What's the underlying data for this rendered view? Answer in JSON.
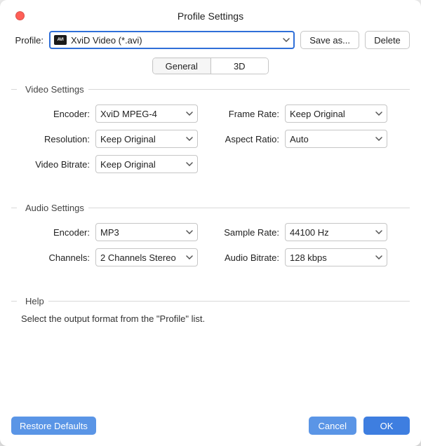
{
  "window": {
    "title": "Profile Settings"
  },
  "profileRow": {
    "label": "Profile:",
    "value": "XviD Video (*.avi)",
    "saveAs": "Save as...",
    "delete": "Delete"
  },
  "tabs": {
    "general": "General",
    "threeD": "3D"
  },
  "video": {
    "title": "Video Settings",
    "encoder": {
      "label": "Encoder:",
      "value": "XviD MPEG-4"
    },
    "resolution": {
      "label": "Resolution:",
      "value": "Keep Original"
    },
    "videoBitrate": {
      "label": "Video Bitrate:",
      "value": "Keep Original"
    },
    "frameRate": {
      "label": "Frame Rate:",
      "value": "Keep Original"
    },
    "aspectRatio": {
      "label": "Aspect Ratio:",
      "value": "Auto"
    }
  },
  "audio": {
    "title": "Audio Settings",
    "encoder": {
      "label": "Encoder:",
      "value": "MP3"
    },
    "channels": {
      "label": "Channels:",
      "value": "2 Channels Stereo"
    },
    "sampleRate": {
      "label": "Sample Rate:",
      "value": "44100 Hz"
    },
    "audioBitrate": {
      "label": "Audio Bitrate:",
      "value": "128 kbps"
    }
  },
  "help": {
    "title": "Help",
    "text": "Select the output format from the \"Profile\" list."
  },
  "footer": {
    "restore": "Restore Defaults",
    "cancel": "Cancel",
    "ok": "OK"
  }
}
